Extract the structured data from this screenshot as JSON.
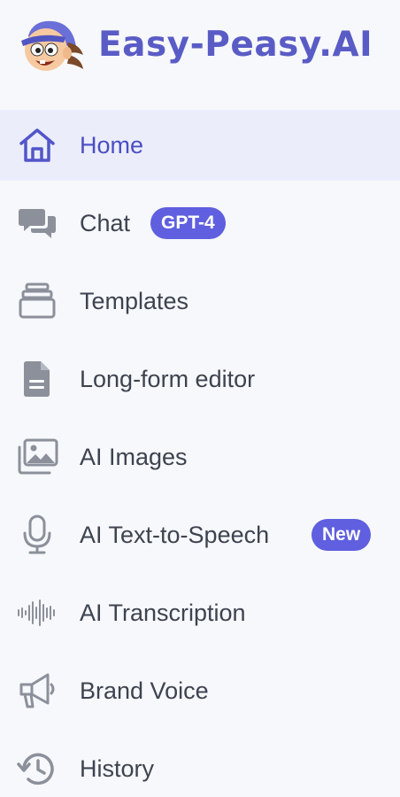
{
  "brand": {
    "name": "Easy-Peasy.AI",
    "color": "#5a5cc6"
  },
  "theme": {
    "accent": "#5f5fe0",
    "active_bg": "#ebedfb",
    "active_text": "#4b4fc3",
    "text": "#3d4350",
    "icon_gray": "#8b909b"
  },
  "nav": {
    "items": [
      {
        "label": "Home",
        "icon": "home-icon",
        "active": true
      },
      {
        "label": "Chat",
        "icon": "chat-bubbles-icon",
        "badge": "GPT-4"
      },
      {
        "label": "Templates",
        "icon": "templates-stack-icon"
      },
      {
        "label": "Long-form editor",
        "icon": "document-icon"
      },
      {
        "label": "AI Images",
        "icon": "images-icon"
      },
      {
        "label": "AI Text-to-Speech",
        "icon": "microphone-icon",
        "badge": "New"
      },
      {
        "label": "AI Transcription",
        "icon": "waveform-icon"
      },
      {
        "label": "Brand Voice",
        "icon": "megaphone-icon"
      },
      {
        "label": "History",
        "icon": "history-icon"
      }
    ]
  }
}
